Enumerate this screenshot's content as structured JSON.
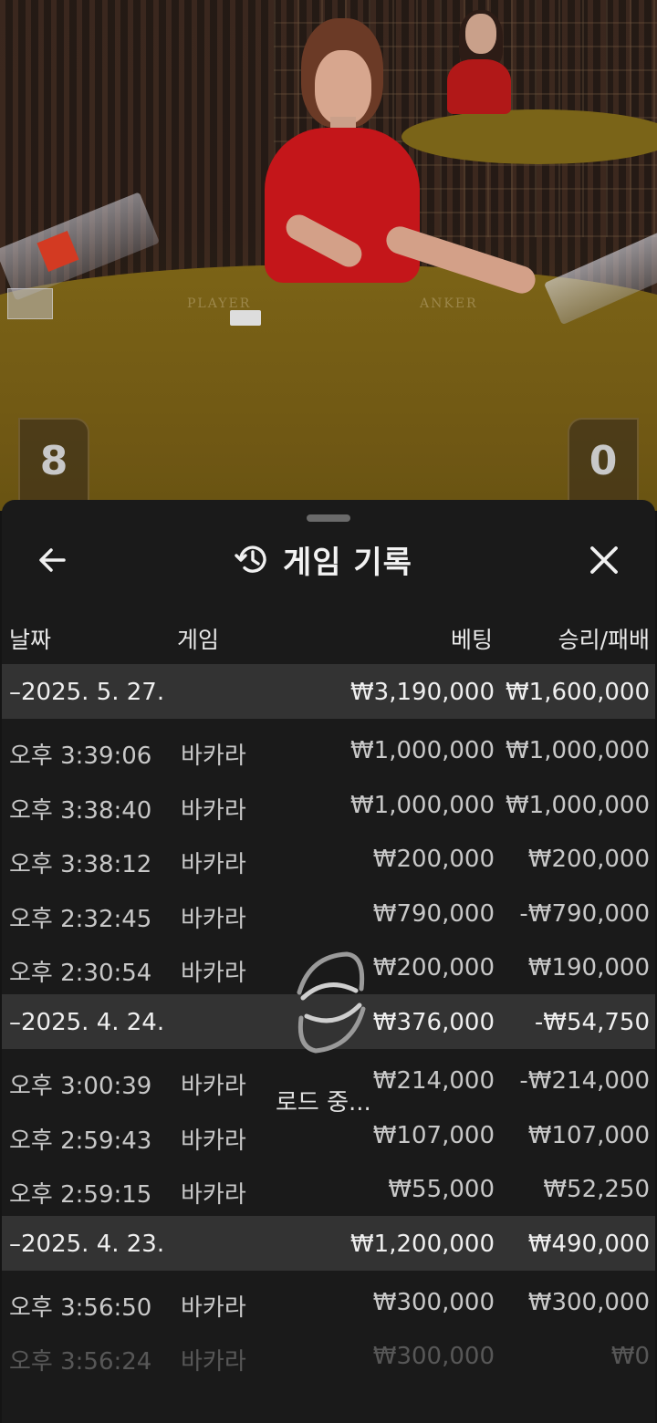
{
  "video": {
    "player_label": "PLAYER",
    "banker_label": "ANKER",
    "player_score": "8",
    "banker_score": "0"
  },
  "sheet": {
    "title": "게임 기록",
    "title_icon": "history-icon",
    "back_icon": "arrow-left-icon",
    "close_icon": "close-icon",
    "loading_text": "로드 중..."
  },
  "columns": {
    "date": "날짜",
    "game": "게임",
    "bet": "베팅",
    "result": "승리/패배"
  },
  "groups": [
    {
      "date": "–2025. 5. 27.",
      "bet_total": "₩3,190,000",
      "result_total": "₩1,600,000",
      "rows": [
        {
          "time": "오후 3:39:06",
          "game": "바카라",
          "bet": "₩1,000,000",
          "result": "₩1,000,000"
        },
        {
          "time": "오후 3:38:40",
          "game": "바카라",
          "bet": "₩1,000,000",
          "result": "₩1,000,000"
        },
        {
          "time": "오후 3:38:12",
          "game": "바카라",
          "bet": "₩200,000",
          "result": "₩200,000"
        },
        {
          "time": "오후 2:32:45",
          "game": "바카라",
          "bet": "₩790,000",
          "result": "-₩790,000"
        },
        {
          "time": "오후 2:30:54",
          "game": "바카라",
          "bet": "₩200,000",
          "result": "₩190,000"
        }
      ]
    },
    {
      "date": "–2025. 4. 24.",
      "bet_total": "₩376,000",
      "result_total": "-₩54,750",
      "rows": [
        {
          "time": "오후 3:00:39",
          "game": "바카라",
          "bet": "₩214,000",
          "result": "-₩214,000"
        },
        {
          "time": "오후 2:59:43",
          "game": "바카라",
          "bet": "₩107,000",
          "result": "₩107,000"
        },
        {
          "time": "오후 2:59:15",
          "game": "바카라",
          "bet": "₩55,000",
          "result": "₩52,250"
        }
      ]
    },
    {
      "date": "–2025. 4. 23.",
      "bet_total": "₩1,200,000",
      "result_total": "₩490,000",
      "rows": [
        {
          "time": "오후 3:56:50",
          "game": "바카라",
          "bet": "₩300,000",
          "result": "₩300,000"
        },
        {
          "time": "오후 3:56:24",
          "game": "바카라",
          "bet": "₩300,000",
          "result": "₩0"
        }
      ]
    }
  ]
}
